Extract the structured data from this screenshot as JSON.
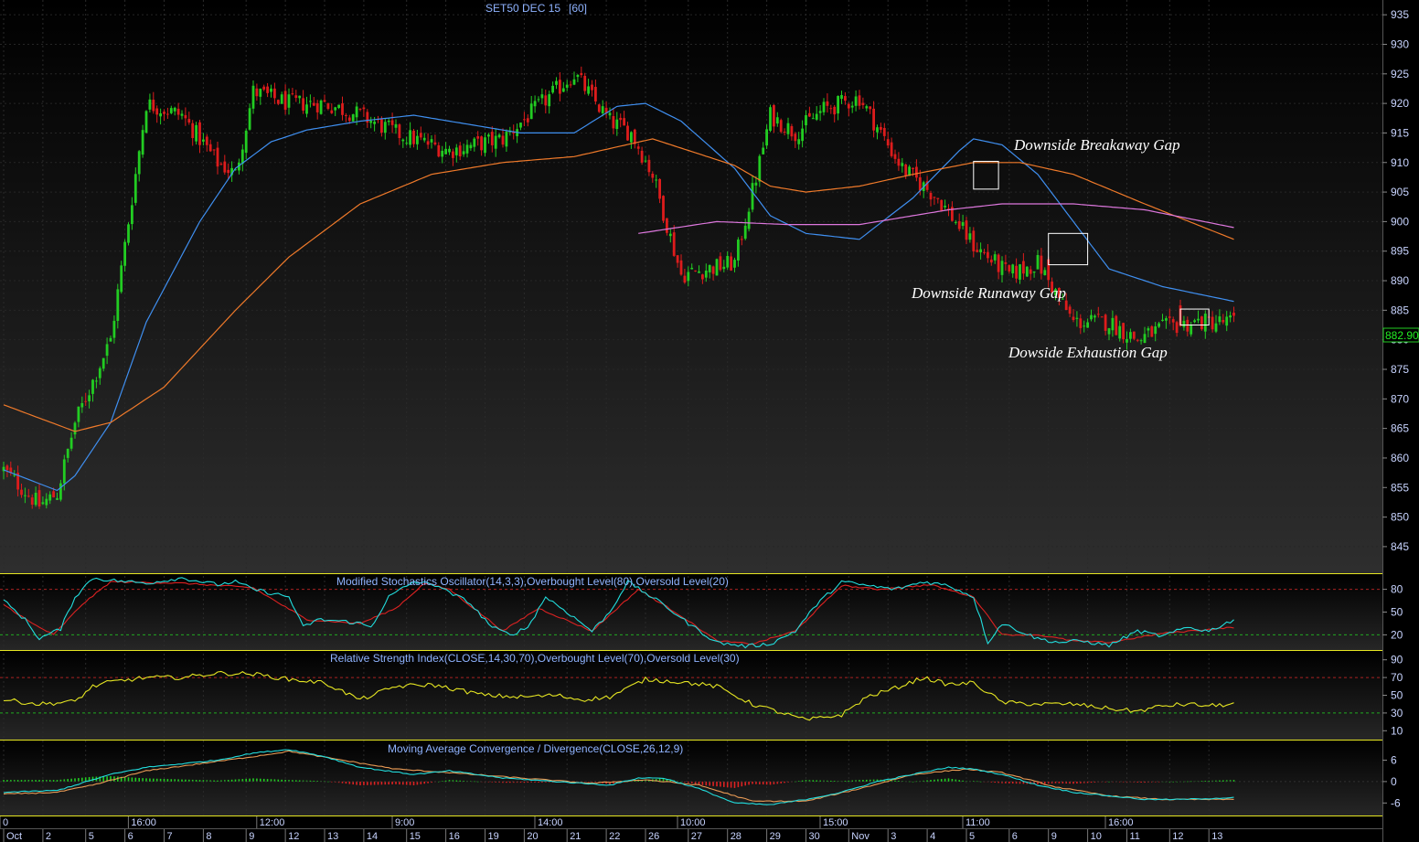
{
  "chart_data": {
    "type": "candlestick",
    "title": "SET50 DEC 15",
    "interval_label": "[60]",
    "last_price_label": "882.90",
    "colors": {
      "background_top": "#000000",
      "background_bottom": "#303030",
      "up_candle": "#22cc22",
      "down_candle": "#dd1c1c",
      "ma_fast": "#3f8ff0",
      "ma_mid": "#f07a2a",
      "ma_slow": "#dd77dd",
      "stoch_k": "#22dddd",
      "stoch_d": "#dd2222",
      "rsi_line": "#e6e622",
      "macd_line": "#22dddd",
      "signal_line": "#e89a55",
      "hist_up": "#22cc22",
      "hist_down": "#dd2222",
      "panel_border": "#e6e622",
      "axis_text": "#c8d4ff",
      "title_text": "#8fb3ff",
      "price_box": "#22cc22"
    },
    "price_axis": {
      "ticks": [
        845,
        850,
        855,
        860,
        865,
        870,
        875,
        880,
        885,
        890,
        895,
        900,
        905,
        910,
        915,
        920,
        925,
        930,
        935
      ],
      "ylim": [
        840.5,
        937.5
      ]
    },
    "time_axis": {
      "hour_labels": [
        "0",
        "16:00",
        "12:00",
        "9:00",
        "14:00",
        "10:00",
        "15:00",
        "11:00",
        "16:00"
      ],
      "day_labels": [
        "Oct",
        "2",
        "5",
        "6",
        "7",
        "8",
        "9",
        "12",
        "13",
        "14",
        "15",
        "16",
        "19",
        "20",
        "21",
        "22",
        "26",
        "27",
        "28",
        "29",
        "30",
        "Nov",
        "3",
        "4",
        "5",
        "6",
        "9",
        "10",
        "11",
        "12",
        "13"
      ]
    },
    "price_series_keypoints": {
      "x_bar_index": [
        0,
        10,
        15,
        20,
        30,
        40,
        50,
        60,
        65,
        70,
        80,
        90,
        100,
        110,
        125,
        140,
        160,
        170,
        176,
        182,
        190,
        205,
        212,
        215,
        222,
        230,
        240,
        252,
        262,
        272,
        282,
        290,
        300,
        310,
        318,
        325,
        335,
        345
      ],
      "close": [
        858,
        852,
        854,
        866,
        880,
        920,
        918,
        910,
        908,
        922,
        920,
        920,
        918,
        915,
        912,
        914,
        925,
        917,
        915,
        908,
        891,
        893,
        910,
        918,
        915,
        919,
        921,
        909,
        904,
        896,
        891,
        893,
        883,
        883,
        880,
        882,
        883,
        883
      ]
    },
    "moving_averages": [
      {
        "x_bar_index": [
          0,
          15,
          20,
          30,
          40,
          55,
          65,
          75,
          85,
          100,
          115,
          130,
          145,
          160,
          172,
          180,
          190,
          205,
          215,
          225,
          240,
          255,
          268,
          272,
          280,
          290,
          300,
          310,
          325,
          345
        ],
        "values": [
          858,
          854.5,
          857,
          866,
          883,
          900,
          909,
          913.5,
          915.5,
          917,
          918,
          916.5,
          915,
          915,
          919.5,
          920,
          917,
          909,
          901,
          898,
          897,
          904,
          912,
          914,
          913,
          908,
          900,
          892,
          889,
          886.5
        ]
      },
      {
        "x_bar_index": [
          0,
          20,
          30,
          45,
          65,
          80,
          100,
          120,
          140,
          160,
          182,
          205,
          215,
          225,
          240,
          255,
          272,
          285,
          300,
          320,
          345
        ],
        "values": [
          869,
          864.5,
          866,
          872,
          885,
          894,
          903,
          908,
          910,
          911,
          914,
          909.5,
          906,
          905,
          906,
          908,
          910,
          910,
          908,
          903,
          897
        ]
      },
      {
        "x_bar_index": [
          178,
          200,
          220,
          240,
          255,
          265,
          280,
          300,
          320,
          345
        ],
        "values": [
          898,
          900,
          899.5,
          899.5,
          901,
          902,
          903,
          903,
          902,
          899
        ]
      }
    ],
    "gap_boxes": [
      {
        "x_bar_index": [
          272,
          279
        ],
        "price_range": [
          905.5,
          910.2
        ]
      },
      {
        "x_bar_index": [
          293,
          304
        ],
        "price_range": [
          892.7,
          898
        ]
      },
      {
        "x_bar_index": [
          330,
          338
        ],
        "price_range": [
          882.5,
          885.2
        ]
      }
    ],
    "annotations": [
      {
        "text": "Downside Breakaway Gap",
        "x_bar_index": 284,
        "price": 914.5
      },
      {
        "text": "Downside Runaway Gap",
        "x_bar_index": 254,
        "price": 889.6
      },
      {
        "text": "Dowside Exhaustion Gap",
        "x_bar_index": 281,
        "price": 879.5
      }
    ],
    "indicators": [
      {
        "name": "Modified Stochastics Oscillator(14,3,3),Overbought Level(80),Oversold Level(20)",
        "ticks": [
          20,
          50,
          80
        ],
        "ylim": [
          0,
          100
        ],
        "overbought": 80,
        "oversold": 20,
        "k_keypoints": {
          "x_bar_index": [
            0,
            6,
            10,
            16,
            20,
            25,
            30,
            40,
            50,
            60,
            65,
            70,
            75,
            80,
            84,
            88,
            95,
            100,
            103,
            108,
            115,
            122,
            125,
            130,
            137,
            142,
            147,
            152,
            158,
            165,
            170,
            175,
            180,
            185,
            192,
            200,
            208,
            215,
            222,
            228,
            235,
            242,
            250,
            258,
            265,
            272,
            276,
            280,
            285,
            290,
            296,
            302,
            310,
            318,
            325,
            332,
            338,
            345
          ],
          "values": [
            65,
            40,
            15,
            28,
            70,
            95,
            92,
            88,
            95,
            86,
            90,
            80,
            75,
            70,
            30,
            40,
            38,
            35,
            30,
            70,
            90,
            85,
            75,
            65,
            30,
            20,
            30,
            70,
            50,
            25,
            50,
            90,
            75,
            60,
            35,
            10,
            5,
            8,
            25,
            60,
            90,
            85,
            80,
            90,
            85,
            70,
            10,
            35,
            25,
            15,
            10,
            12,
            6,
            25,
            18,
            30,
            25,
            40
          ]
        },
        "d_keypoints": {
          "x_bar_index": [
            0,
            8,
            14,
            22,
            30,
            50,
            70,
            85,
            100,
            110,
            118,
            125,
            140,
            150,
            165,
            178,
            190,
            200,
            210,
            222,
            235,
            245,
            260,
            272,
            280,
            290,
            300,
            310,
            325,
            345
          ],
          "values": [
            60,
            35,
            20,
            60,
            90,
            88,
            82,
            40,
            35,
            55,
            88,
            80,
            25,
            55,
            25,
            80,
            45,
            12,
            8,
            25,
            85,
            80,
            86,
            70,
            20,
            20,
            12,
            10,
            22,
            30
          ]
        }
      },
      {
        "name": "Relative Strength Index(CLOSE,14,30,70),Overbought Level(70),Oversold Level(30)",
        "ticks": [
          10,
          30,
          50,
          70,
          90
        ],
        "ylim": [
          0,
          100
        ],
        "overbought": 70,
        "oversold": 30,
        "rsi_keypoints": {
          "x_bar_index": [
            0,
            10,
            20,
            25,
            30,
            40,
            50,
            60,
            70,
            80,
            90,
            100,
            110,
            120,
            135,
            145,
            155,
            162,
            170,
            180,
            190,
            200,
            210,
            225,
            235,
            242,
            250,
            258,
            265,
            272,
            280,
            290,
            300,
            310,
            318,
            325,
            332,
            338,
            345
          ],
          "values": [
            45,
            40,
            43,
            60,
            65,
            70,
            70,
            75,
            74,
            68,
            64,
            45,
            60,
            62,
            50,
            48,
            50,
            45,
            48,
            68,
            65,
            60,
            40,
            22,
            28,
            48,
            58,
            70,
            62,
            64,
            42,
            40,
            40,
            35,
            32,
            38,
            40,
            38,
            40
          ]
        }
      },
      {
        "name": "Moving Average Convergence / Divergence(CLOSE,26,12,9)",
        "ticks": [
          -6,
          0,
          6
        ],
        "ylim": [
          -9.5,
          11.5
        ],
        "macd_keypoints": {
          "x_bar_index": [
            0,
            15,
            20,
            30,
            40,
            50,
            60,
            70,
            80,
            90,
            100,
            115,
            125,
            140,
            155,
            170,
            178,
            185,
            195,
            205,
            215,
            225,
            235,
            245,
            255,
            265,
            272,
            280,
            290,
            300,
            310,
            320,
            330,
            345
          ],
          "values": [
            -3,
            -2.5,
            -1,
            2,
            4,
            5,
            6,
            8,
            9,
            7,
            4,
            2,
            3,
            1,
            0,
            -1,
            1,
            1,
            -2,
            -6,
            -6.5,
            -5,
            -3,
            0,
            2,
            4,
            3.5,
            2,
            -1,
            -3,
            -4,
            -5,
            -5,
            -4.5
          ]
        },
        "signal_keypoints": {
          "x_bar_index": [
            0,
            15,
            25,
            40,
            55,
            70,
            80,
            95,
            110,
            125,
            145,
            165,
            180,
            195,
            210,
            225,
            240,
            255,
            270,
            280,
            295,
            310,
            325,
            345
          ],
          "values": [
            -3.5,
            -3,
            -1,
            3,
            5,
            7,
            8.5,
            6,
            3.5,
            2.5,
            1,
            -0.5,
            0.5,
            -1,
            -5.5,
            -5.5,
            -2,
            2,
            3.5,
            2.5,
            -1.5,
            -4,
            -5,
            -5
          ]
        }
      }
    ]
  }
}
